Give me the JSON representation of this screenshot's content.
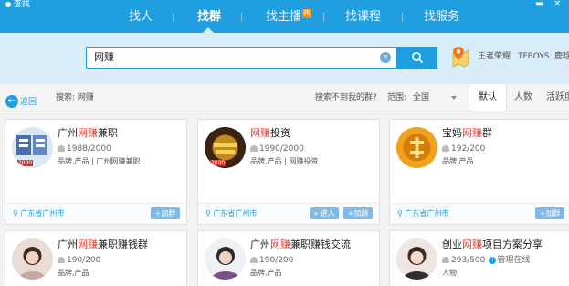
{
  "app": {
    "title": "查找"
  },
  "nav": {
    "items": [
      "找人",
      "找群",
      "找主播",
      "找课程",
      "找服务"
    ],
    "hot_badge": "热"
  },
  "window_controls": [
    "minimize-icon",
    "close-icon"
  ],
  "search": {
    "value": "网赚",
    "clear_icon": "×",
    "button_icon": "search-icon",
    "hot_words": [
      "王者荣耀",
      "TFBOYS",
      "鹿晗"
    ]
  },
  "filter": {
    "back_label": "返回",
    "search_label": "搜索: 网赚",
    "not_found": "搜索不到我的群?",
    "range_label": "范围:",
    "range_value": "全国",
    "sort_tabs": [
      "默认",
      "人数",
      "活跃度"
    ]
  },
  "cards": [
    {
      "prefix": "广州",
      "highlight": "网赚",
      "suffix": "兼职",
      "members": "1988/2000",
      "tags": "品牌,产品  |  广州网赚兼职",
      "location": "广东省广州市",
      "enter": "",
      "join": "+加群",
      "level": "2000"
    },
    {
      "prefix": "",
      "highlight": "网赚",
      "suffix": "投资",
      "members": "1990/2000",
      "tags": "品牌,产品  |  网赚投资",
      "location": "广东省广州市",
      "enter": "» 进入",
      "join": "+加群",
      "level": "2000"
    },
    {
      "prefix": "宝妈",
      "highlight": "网赚",
      "suffix": "群",
      "members": "192/200",
      "tags": "品牌,产品",
      "location": "广东省广州市",
      "enter": "",
      "join": "+加群",
      "level": ""
    },
    {
      "prefix": "广州",
      "highlight": "网赚",
      "suffix": "兼职赚钱群",
      "members": "190/200",
      "tags": "品牌,产品",
      "location": "",
      "enter": "",
      "join": "",
      "level": ""
    },
    {
      "prefix": "广州",
      "highlight": "网赚",
      "suffix": "兼职赚钱交流",
      "members": "190/200",
      "tags": "品牌,产品",
      "location": "",
      "enter": "",
      "join": "",
      "level": ""
    },
    {
      "prefix": "创业",
      "highlight": "网赚",
      "suffix": "项目方案分享",
      "members": "293/500",
      "managed": "管理在线",
      "tags": "人物",
      "location": "",
      "enter": "",
      "join": "",
      "level": ""
    }
  ],
  "colors": {
    "primary": "#1f9ee0",
    "highlight": "#e8382e",
    "search_band": "#d9edf9"
  }
}
